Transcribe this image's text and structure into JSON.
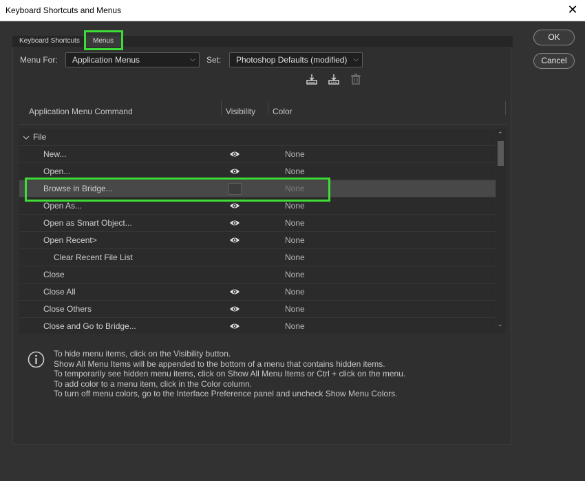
{
  "window": {
    "title": "Keyboard Shortcuts and Menus",
    "close_glyph": "✕"
  },
  "tabs": [
    {
      "label": "Keyboard Shortcuts",
      "active": false
    },
    {
      "label": "Menus",
      "active": true
    }
  ],
  "menu_for": {
    "label": "Menu For:",
    "value": "Application Menus"
  },
  "set": {
    "label": "Set:",
    "value": "Photoshop Defaults (modified)"
  },
  "toolbar_icons": [
    "save-set-icon",
    "save-set-as-icon",
    "delete-set-icon"
  ],
  "buttons": {
    "ok": "OK",
    "cancel": "Cancel"
  },
  "table": {
    "columns": {
      "command": "Application Menu Command",
      "visibility": "Visibility",
      "color": "Color"
    },
    "group": {
      "label": "File",
      "expanded": true
    },
    "rows": [
      {
        "label": "New...",
        "visible": true,
        "color": "None",
        "indent": 1
      },
      {
        "label": "Open...",
        "visible": true,
        "color": "None",
        "indent": 1
      },
      {
        "label": "Browse in Bridge...",
        "visible": false,
        "color": "None",
        "indent": 1,
        "selected": true
      },
      {
        "label": "Open As...",
        "visible": true,
        "color": "None",
        "indent": 1
      },
      {
        "label": "Open as Smart Object...",
        "visible": true,
        "color": "None",
        "indent": 1
      },
      {
        "label": "Open Recent>",
        "visible": true,
        "color": "None",
        "indent": 1
      },
      {
        "label": "Clear Recent File List",
        "visible": null,
        "color": "None",
        "indent": 2
      },
      {
        "label": "Close",
        "visible": null,
        "color": "None",
        "indent": 1
      },
      {
        "label": "Close All",
        "visible": true,
        "color": "None",
        "indent": 1
      },
      {
        "label": "Close Others",
        "visible": true,
        "color": "None",
        "indent": 1
      },
      {
        "label": "Close and Go to Bridge...",
        "visible": true,
        "color": "None",
        "indent": 1
      }
    ]
  },
  "info_lines": [
    "To hide menu items, click on the Visibility button.",
    "Show All Menu Items will be appended to the bottom of a menu that contains hidden items.",
    "To temporarily see hidden menu items, click on Show All Menu Items or Ctrl + click on the menu.",
    "To add color to a menu item, click in the Color column.",
    "To turn off menu colors, go to the Interface Preference panel and uncheck Show Menu Colors."
  ],
  "colors": {
    "highlight": "#3ddc37",
    "panel": "#2f2f2f",
    "selected_row": "#484848"
  }
}
